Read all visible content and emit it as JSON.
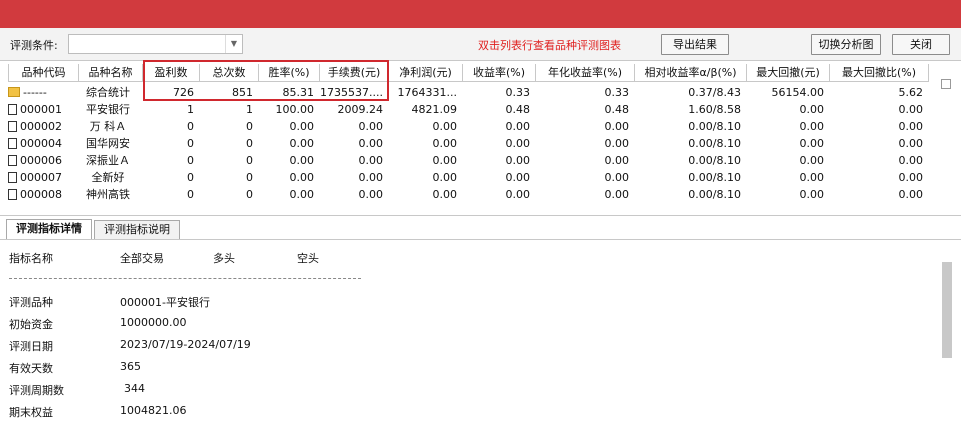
{
  "toolbar": {
    "condition_label": "评测条件:",
    "condition_value": "",
    "hint": "双击列表行查看品种评测图表",
    "export_button": "导出结果",
    "switch_button": "切换分析图",
    "close_button": "关闭"
  },
  "table": {
    "columns": [
      "品种代码",
      "品种名称",
      "盈利数",
      "总次数",
      "胜率(%)",
      "手续费(元)",
      "净利润(元)",
      "收益率(%)",
      "年化收益率(%)",
      "相对收益率α/β(%)",
      "最大回撤(元)",
      "最大回撤比(%)"
    ],
    "rows": [
      [
        "------",
        "综合统计",
        "726",
        "851",
        "85.31",
        "1735537....",
        "1764331...",
        "0.33",
        "0.33",
        "0.37/8.43",
        "56154.00",
        "5.62"
      ],
      [
        "000001",
        "平安银行",
        "1",
        "1",
        "100.00",
        "2009.24",
        "4821.09",
        "0.48",
        "0.48",
        "1.60/8.58",
        "0.00",
        "0.00"
      ],
      [
        "000002",
        "万 科Ａ",
        "0",
        "0",
        "0.00",
        "0.00",
        "0.00",
        "0.00",
        "0.00",
        "0.00/8.10",
        "0.00",
        "0.00"
      ],
      [
        "000004",
        "国华网安",
        "0",
        "0",
        "0.00",
        "0.00",
        "0.00",
        "0.00",
        "0.00",
        "0.00/8.10",
        "0.00",
        "0.00"
      ],
      [
        "000006",
        "深振业Ａ",
        "0",
        "0",
        "0.00",
        "0.00",
        "0.00",
        "0.00",
        "0.00",
        "0.00/8.10",
        "0.00",
        "0.00"
      ],
      [
        "000007",
        "全新好",
        "0",
        "0",
        "0.00",
        "0.00",
        "0.00",
        "0.00",
        "0.00",
        "0.00/8.10",
        "0.00",
        "0.00"
      ],
      [
        "000008",
        "神州高铁",
        "0",
        "0",
        "0.00",
        "0.00",
        "0.00",
        "0.00",
        "0.00",
        "0.00/8.10",
        "0.00",
        "0.00"
      ]
    ]
  },
  "tabs": [
    "评测指标详情",
    "评测指标说明"
  ],
  "details": {
    "headers": [
      "指标名称",
      "全部交易",
      "多头",
      "空头"
    ],
    "items": [
      {
        "label": "评测品种",
        "value": "000001-平安银行"
      },
      {
        "label": "初始资金",
        "value": "1000000.00"
      },
      {
        "label": "评测日期",
        "value": "2023/07/19-2024/07/19"
      },
      {
        "label": "有效天数",
        "value": "365"
      },
      {
        "label": "评测周期数",
        "value": "344"
      },
      {
        "label": "期末权益",
        "value": "1004821.06"
      }
    ]
  },
  "colors": {
    "titlebar": "#d13a3e",
    "hint": "#e0201f",
    "highlight_box": "#d0282e"
  }
}
